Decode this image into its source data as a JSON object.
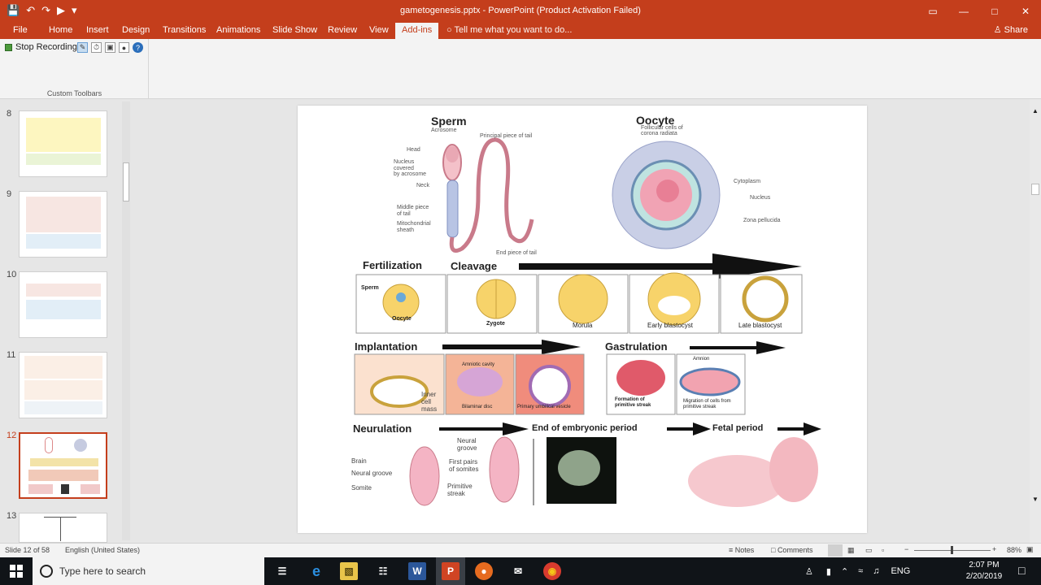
{
  "titlebar": {
    "title": "gametogenesis.pptx - PowerPoint (Product Activation Failed)",
    "min": "—",
    "restore": "□",
    "close": "✕",
    "ribbon_display": "▭"
  },
  "qat": {
    "save": "💾",
    "undo": "↶",
    "redo": "↷",
    "start": "▶",
    "more": "▾"
  },
  "tabs": [
    "File",
    "Home",
    "Insert",
    "Design",
    "Transitions",
    "Animations",
    "Slide Show",
    "Review",
    "View",
    "Add-ins"
  ],
  "active_tab": "Add-ins",
  "tellme": "Tell me what you want to do...",
  "share": "Share",
  "ribbon": {
    "stop_recording": "Stop Recording",
    "group_label": "Custom Toolbars"
  },
  "thumbnails": [
    {
      "num": "8"
    },
    {
      "num": "9"
    },
    {
      "num": "10"
    },
    {
      "num": "11"
    },
    {
      "num": "12"
    },
    {
      "num": "13"
    }
  ],
  "slide": {
    "sperm": {
      "title": "Sperm",
      "acrosome": "Acrosome",
      "principal": "Principal piece of tail",
      "head": "Head",
      "nucleus": "Nucleus",
      "covered": "covered",
      "by_acrosome": "by acrosome",
      "neck": "Neck",
      "middle": "Middle piece",
      "of_tail": "of tail",
      "mito": "Mitochondrial",
      "sheath": "sheath",
      "end": "End piece of tail"
    },
    "oocyte": {
      "title": "Oocyte",
      "follicular": "Follicular cells of",
      "corona": "corona radiata",
      "cytoplasm": "Cytoplasm",
      "nucleus": "Nucleus",
      "zona": "Zona pellucida"
    },
    "row1": {
      "fertilization": "Fertilization",
      "cleavage": "Cleavage",
      "sperm": "Sperm",
      "oocyte": "Oocyte",
      "zygote": "Zygote",
      "morula": "Morula",
      "early": "Early blastocyst",
      "late": "Late blastocyst"
    },
    "row2": {
      "implantation": "Implantation",
      "amniotic": "Amniotic cavity",
      "inner": "Inner",
      "cell": "cell",
      "mass": "mass",
      "bilaminar": "Bilaminar disc",
      "umbilical": "Primary umbilical vesicle",
      "gastrulation": "Gastrulation",
      "amnion": "Amnion",
      "formation": "Formation of",
      "streak": "primitive streak",
      "migration": "Migration of cells from",
      "mig_streak": "primitive streak"
    },
    "row3": {
      "neurulation": "Neurulation",
      "end_period": "End of embryonic period",
      "fetal": "Fetal period",
      "brain": "Brain",
      "neural_groove": "Neural groove",
      "somite": "Somite",
      "neural": "Neural",
      "groove": "groove",
      "first_pairs": "First pairs",
      "of_somites": "of somites",
      "primitive": "Primitive",
      "streak2": "streak"
    }
  },
  "status": {
    "slide_of": "Slide 12 of 58",
    "language": "English (United States)",
    "notes": "Notes",
    "comments": "Comments",
    "zoom": "88%"
  },
  "taskbar": {
    "search": "Type here to search",
    "lang": "ENG",
    "time": "2:07 PM",
    "date": "2/20/2019"
  }
}
